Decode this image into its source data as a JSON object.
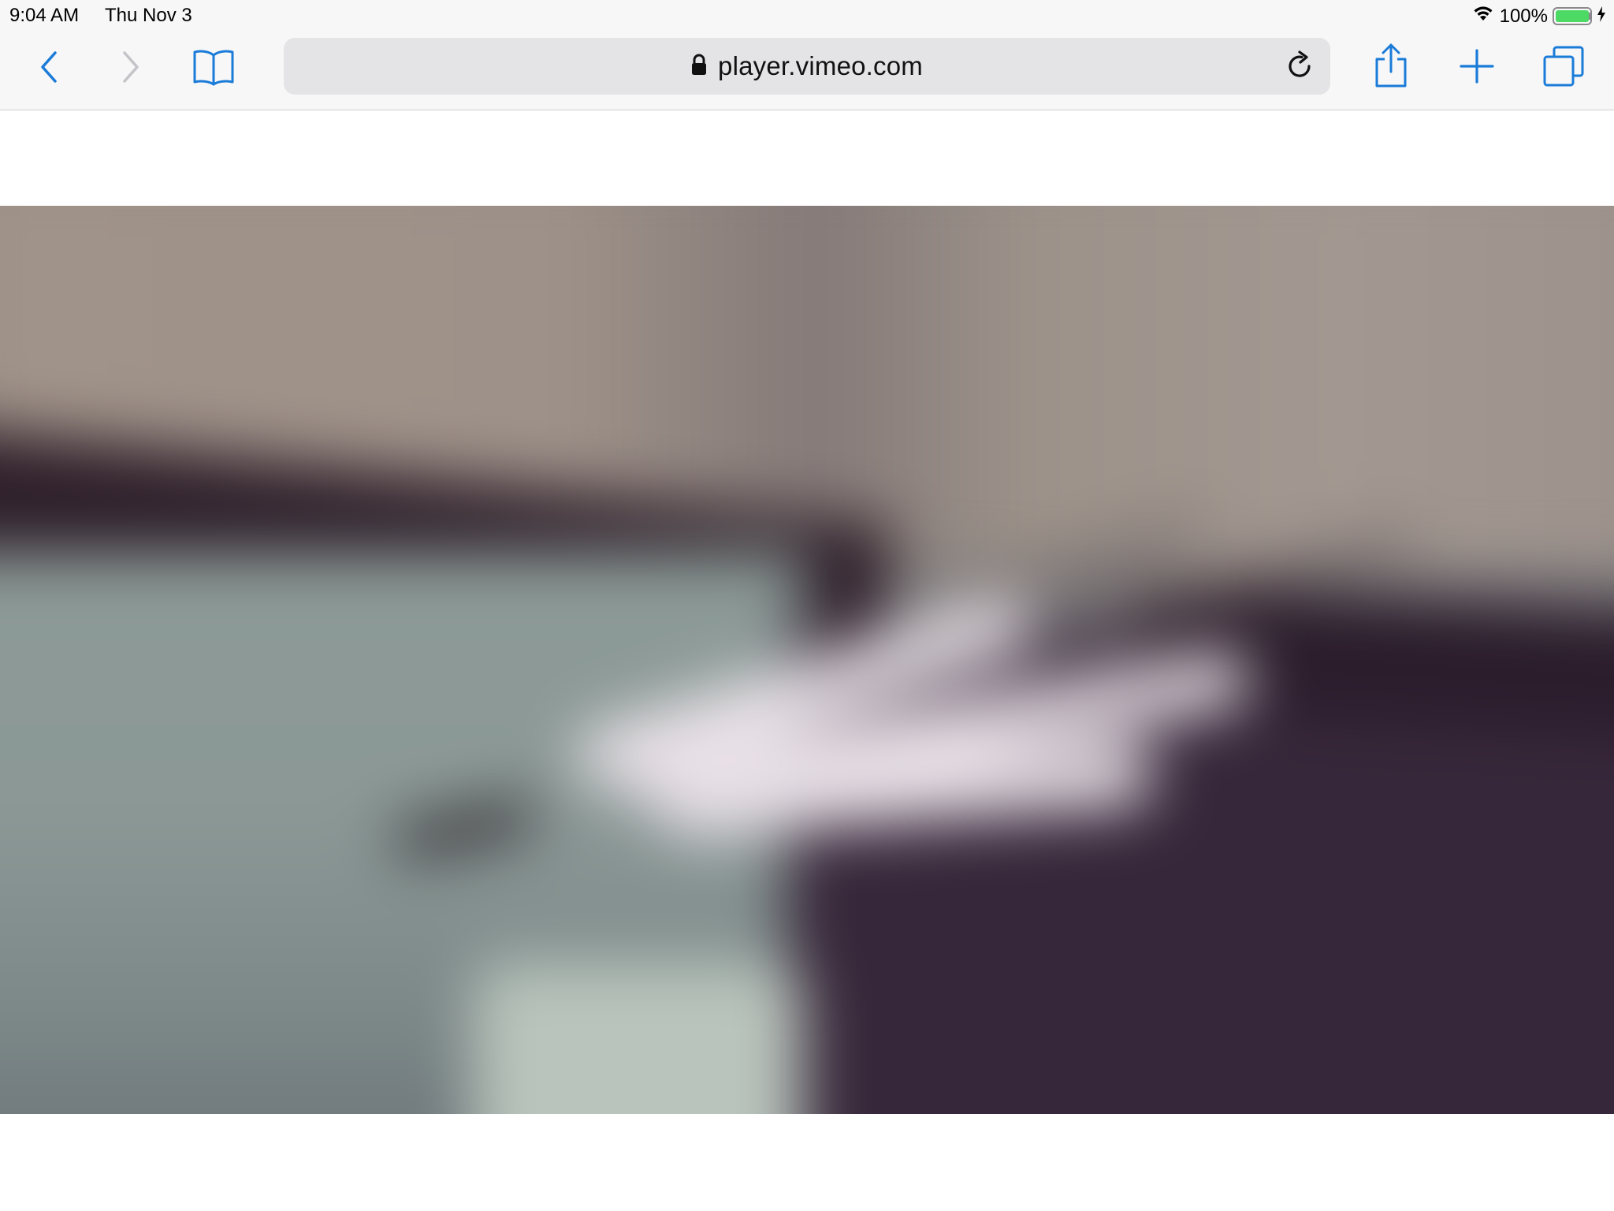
{
  "status_bar": {
    "time": "9:04 AM",
    "date": "Thu Nov 3",
    "battery_percent": "100%",
    "wifi_icon": "wifi-icon",
    "battery_icon": "battery-icon",
    "charging_icon": "bolt-icon"
  },
  "toolbar": {
    "back_icon": "chevron-left-icon",
    "forward_icon": "chevron-right-icon",
    "bookmarks_icon": "book-icon",
    "share_icon": "share-icon",
    "new_tab_icon": "plus-icon",
    "tabs_icon": "tabs-icon",
    "accent_color": "#1a7bd8"
  },
  "address_bar": {
    "lock_icon": "lock-icon",
    "url": "player.vimeo.com",
    "reload_icon": "reload-icon"
  }
}
